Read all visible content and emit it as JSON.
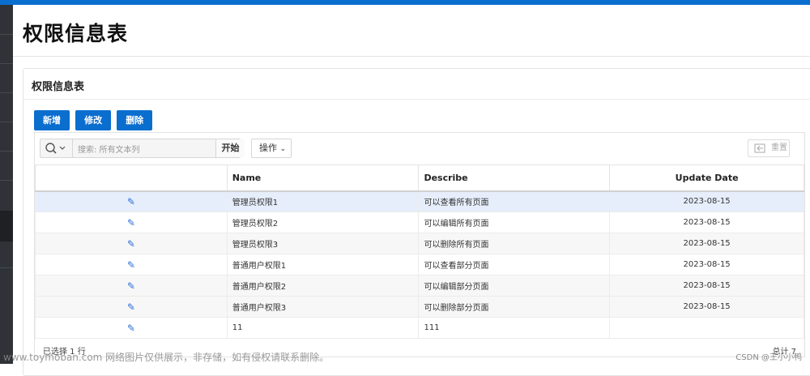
{
  "page": {
    "title": "权限信息表"
  },
  "panel": {
    "title": "权限信息表"
  },
  "buttons": {
    "add": "新增",
    "edit": "修改",
    "delete": "删除"
  },
  "toolbar": {
    "search_placeholder": "搜索: 所有文本列",
    "start_label": "开始",
    "actions_label": "操作",
    "reset_label": "重置"
  },
  "table": {
    "headers": [
      "",
      "Name",
      "Describe",
      "Update Date"
    ],
    "rows": [
      {
        "name": "管理员权限1",
        "describe": "可以查看所有页面",
        "date": "2023-08-15"
      },
      {
        "name": "管理员权限2",
        "describe": "可以编辑所有页面",
        "date": "2023-08-15"
      },
      {
        "name": "管理员权限3",
        "describe": "可以删除所有页面",
        "date": "2023-08-15"
      },
      {
        "name": "普通用户权限1",
        "describe": "可以查看部分页面",
        "date": "2023-08-15"
      },
      {
        "name": "普通用户权限2",
        "describe": "可以编辑部分页面",
        "date": "2023-08-15"
      },
      {
        "name": "普通用户权限3",
        "describe": "可以删除部分页面",
        "date": "2023-08-15"
      },
      {
        "name": "11",
        "describe": "111",
        "date": ""
      }
    ]
  },
  "footer": {
    "selected": "已选择 1 行",
    "total": "总计 7"
  },
  "watermark": {
    "left": "www.toymoban.com 网络图片仅供展示，非存储，如有侵权请联系删除。",
    "right": "CSDN @王小小鸭"
  },
  "colors": {
    "accent": "#0a6ecf",
    "selected_row": "#e6eefb",
    "sidebar": "#2f3337"
  },
  "icons": {
    "search": "search-icon",
    "edit": "edit-icon",
    "reset": "reset-icon",
    "chevron": "chevron-down-icon"
  }
}
